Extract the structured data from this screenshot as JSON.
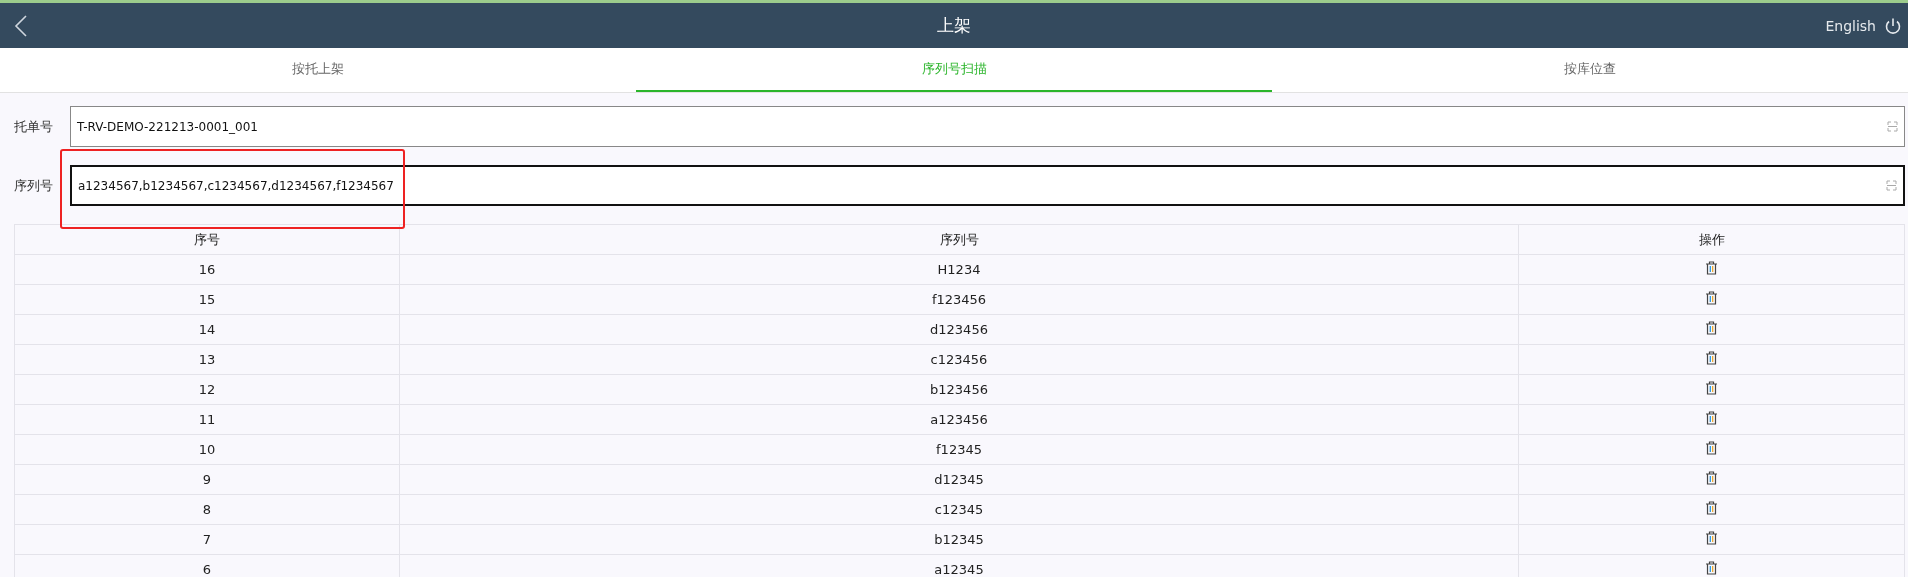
{
  "header": {
    "title": "上架",
    "language": "English"
  },
  "tabs": [
    {
      "label": "按托上架",
      "selected": false
    },
    {
      "label": "序列号扫描",
      "selected": true
    },
    {
      "label": "按库位查",
      "selected": false
    }
  ],
  "fields": [
    {
      "label": "托单号",
      "value": "T-RV-DEMO-221213-0001_001",
      "focused": false,
      "highlighted": false
    },
    {
      "label": "序列号",
      "value": "a1234567,b1234567,c1234567,d1234567,f1234567",
      "focused": true,
      "highlighted": true
    }
  ],
  "table": {
    "columns": [
      "序号",
      "序列号",
      "操作"
    ],
    "rows": [
      {
        "index": "16",
        "serial": "H1234"
      },
      {
        "index": "15",
        "serial": "f123456"
      },
      {
        "index": "14",
        "serial": "d123456"
      },
      {
        "index": "13",
        "serial": "c123456"
      },
      {
        "index": "12",
        "serial": "b123456"
      },
      {
        "index": "11",
        "serial": "a123456"
      },
      {
        "index": "10",
        "serial": "f12345"
      },
      {
        "index": "9",
        "serial": "d12345"
      },
      {
        "index": "8",
        "serial": "c12345"
      },
      {
        "index": "7",
        "serial": "b12345"
      },
      {
        "index": "6",
        "serial": "a12345"
      }
    ]
  }
}
